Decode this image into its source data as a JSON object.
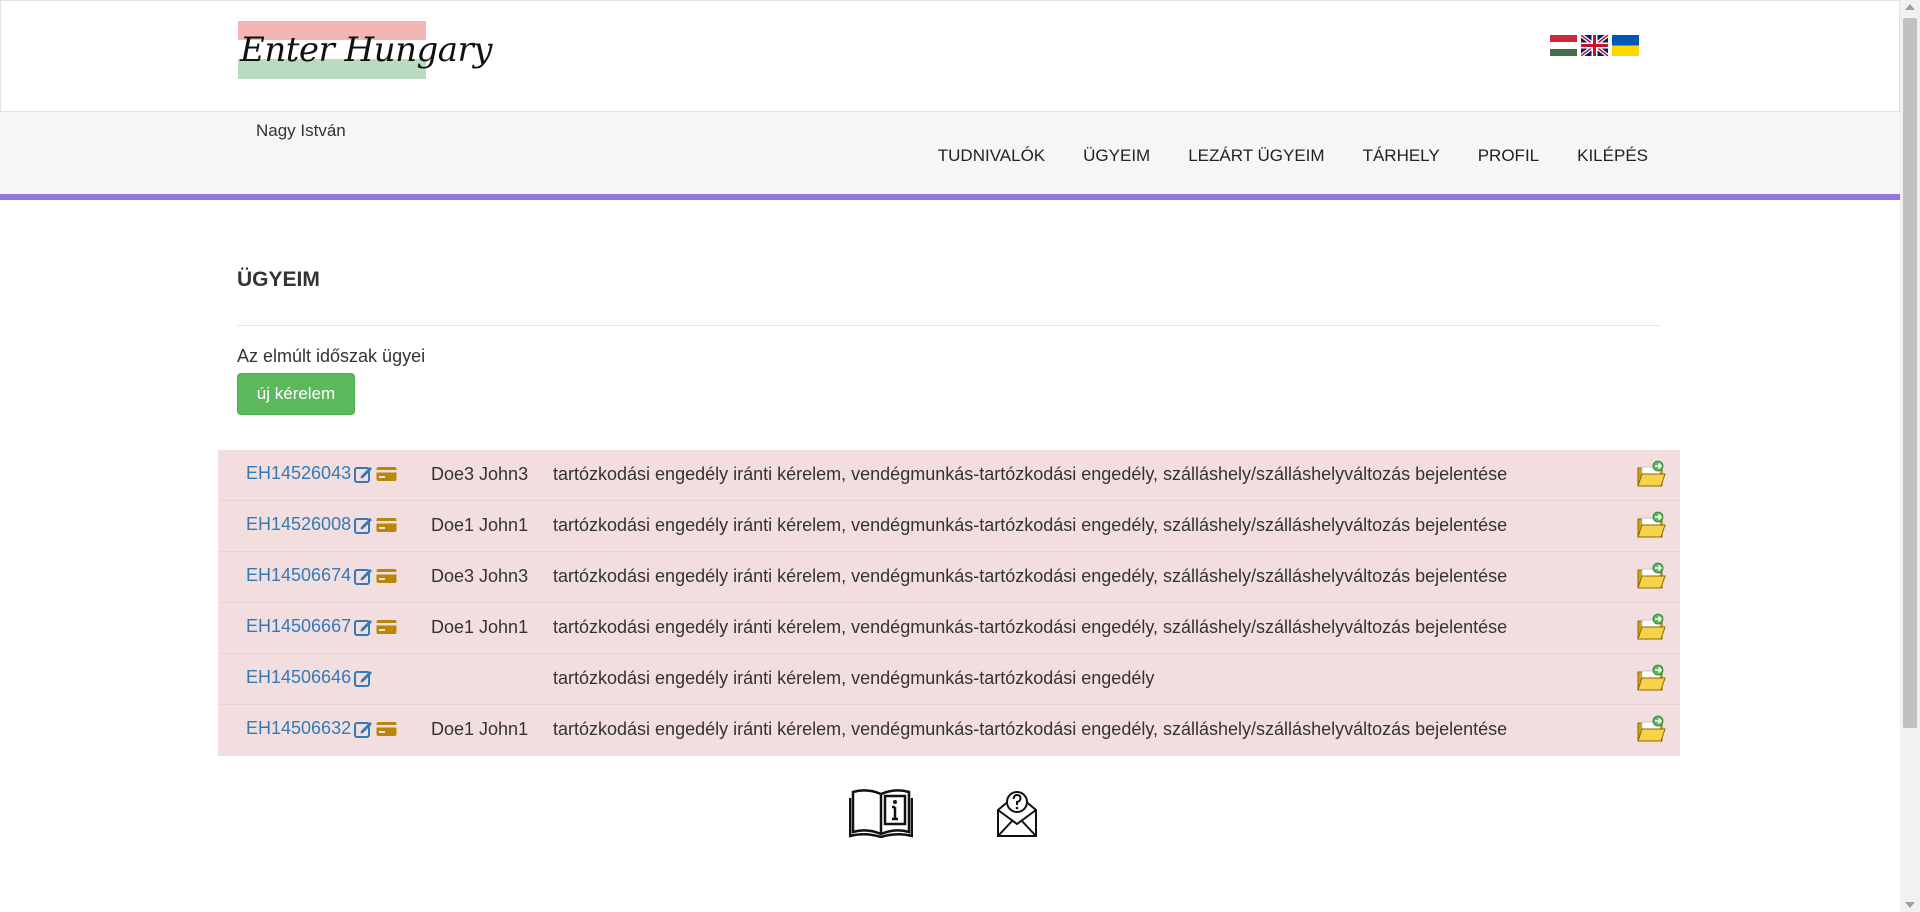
{
  "brand": {
    "logo_text": "Enter Hungary"
  },
  "languages": [
    {
      "name": "hungarian-flag-icon",
      "colors": [
        "#cd2a3e",
        "#ffffff",
        "#436f4d"
      ]
    },
    {
      "name": "uk-flag-icon",
      "colors": [
        "#012169",
        "#ffffff",
        "#c8102e"
      ]
    },
    {
      "name": "ukraine-flag-icon",
      "colors": [
        "#0057b7",
        "#ffd700"
      ]
    }
  ],
  "nav": {
    "user_name": "Nagy István",
    "items": [
      "TUDNIVALÓK",
      "ÜGYEIM",
      "LEZÁRT ÜGYEIM",
      "TÁRHELY",
      "PROFIL",
      "KILÉPÉS"
    ],
    "accent_color": "#9575e2"
  },
  "main": {
    "title": "ÜGYEIM",
    "subtitle": "Az elmúlt időszak ügyei",
    "new_button": "új kérelem"
  },
  "cases": {
    "rows": [
      {
        "id": "EH14526043",
        "has_card": true,
        "name": "Doe3 John3",
        "description": "tartózkodási engedély iránti kérelem, vendégmunkás-tartózkodási engedély, szálláshely/szálláshelyváltozás bejelentése"
      },
      {
        "id": "EH14526008",
        "has_card": true,
        "name": "Doe1 John1",
        "description": "tartózkodási engedély iránti kérelem, vendégmunkás-tartózkodási engedély, szálláshely/szálláshelyváltozás bejelentése"
      },
      {
        "id": "EH14506674",
        "has_card": true,
        "name": "Doe3 John3",
        "description": "tartózkodási engedély iránti kérelem, vendégmunkás-tartózkodási engedély, szálláshely/szálláshelyváltozás bejelentése"
      },
      {
        "id": "EH14506667",
        "has_card": true,
        "name": "Doe1 John1",
        "description": "tartózkodási engedély iránti kérelem, vendégmunkás-tartózkodási engedély, szálláshely/szálláshelyváltozás bejelentése"
      },
      {
        "id": "EH14506646",
        "has_card": false,
        "name": "",
        "description": "tartózkodási engedély iránti kérelem, vendégmunkás-tartózkodási engedély"
      },
      {
        "id": "EH14506632",
        "has_card": true,
        "name": "Doe1 John1",
        "description": "tartózkodási engedély iránti kérelem, vendégmunkás-tartózkodási engedély, szálláshely/szálláshelyváltozás bejelentése"
      }
    ],
    "row_color": "#f2dede",
    "link_color": "#337ab7",
    "edit_icon": "edit-icon",
    "card_icon": "credit-card-icon",
    "folder_icon": "folder-open-icon"
  },
  "footer_icons": [
    "info-book-icon",
    "help-mail-icon"
  ]
}
